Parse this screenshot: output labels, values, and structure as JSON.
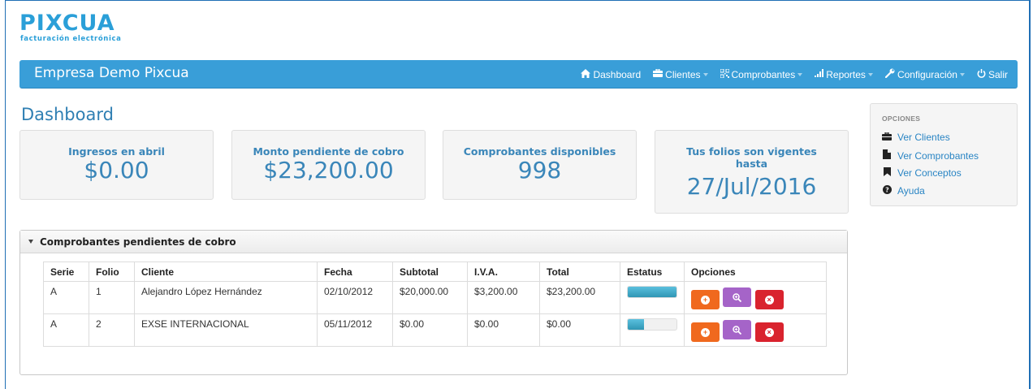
{
  "logo": {
    "word": "PIXCUA",
    "sub": "facturación electrónica"
  },
  "navbar": {
    "brand": "Empresa Demo Pixcua",
    "items": [
      {
        "label": "Dashboard",
        "icon": "home-icon",
        "dropdown": false
      },
      {
        "label": "Clientes",
        "icon": "briefcase-icon",
        "dropdown": true
      },
      {
        "label": "Comprobantes",
        "icon": "qrcode-icon",
        "dropdown": true
      },
      {
        "label": "Reportes",
        "icon": "signal-icon",
        "dropdown": true
      },
      {
        "label": "Configuración",
        "icon": "wrench-icon",
        "dropdown": true
      },
      {
        "label": "Salir",
        "icon": "power-icon",
        "dropdown": false
      }
    ]
  },
  "page": {
    "title": "Dashboard"
  },
  "stats": [
    {
      "label": "Ingresos en abril",
      "value": "$0.00"
    },
    {
      "label": "Monto pendiente de cobro",
      "value": "$23,200.00"
    },
    {
      "label": "Comprobantes disponibles",
      "value": "998"
    },
    {
      "label": "Tus folios son vigentes hasta",
      "value": "27/Jul/2016"
    }
  ],
  "sidebar": {
    "heading": "OPCIONES",
    "items": [
      {
        "label": "Ver Clientes",
        "icon": "briefcase-icon"
      },
      {
        "label": "Ver Comprobantes",
        "icon": "file-icon"
      },
      {
        "label": "Ver Conceptos",
        "icon": "bookmark-icon"
      },
      {
        "label": "Ayuda",
        "icon": "question-circle-icon"
      }
    ]
  },
  "panel": {
    "title": "Comprobantes pendientes de cobro",
    "columns": [
      "Serie",
      "Folio",
      "Cliente",
      "Fecha",
      "Subtotal",
      "I.V.A.",
      "Total",
      "Estatus",
      "Opciones"
    ],
    "rows": [
      {
        "serie": "A",
        "folio": "1",
        "cliente": "Alejandro López Hernández",
        "fecha": "02/10/2012",
        "subtotal": "$20,000.00",
        "iva": "$3,200.00",
        "total": "$23,200.00",
        "progress": 1.0
      },
      {
        "serie": "A",
        "folio": "2",
        "cliente": "EXSE INTERNACIONAL",
        "fecha": "05/11/2012",
        "subtotal": "$0.00",
        "iva": "$0.00",
        "total": "$0.00",
        "progress": 0.33
      }
    ]
  },
  "colors": {
    "navbar": "#399ed8",
    "accent": "#3a86b9",
    "btn_orange": "#f0691e",
    "btn_purple": "#a564c8",
    "btn_red": "#d9232e"
  }
}
